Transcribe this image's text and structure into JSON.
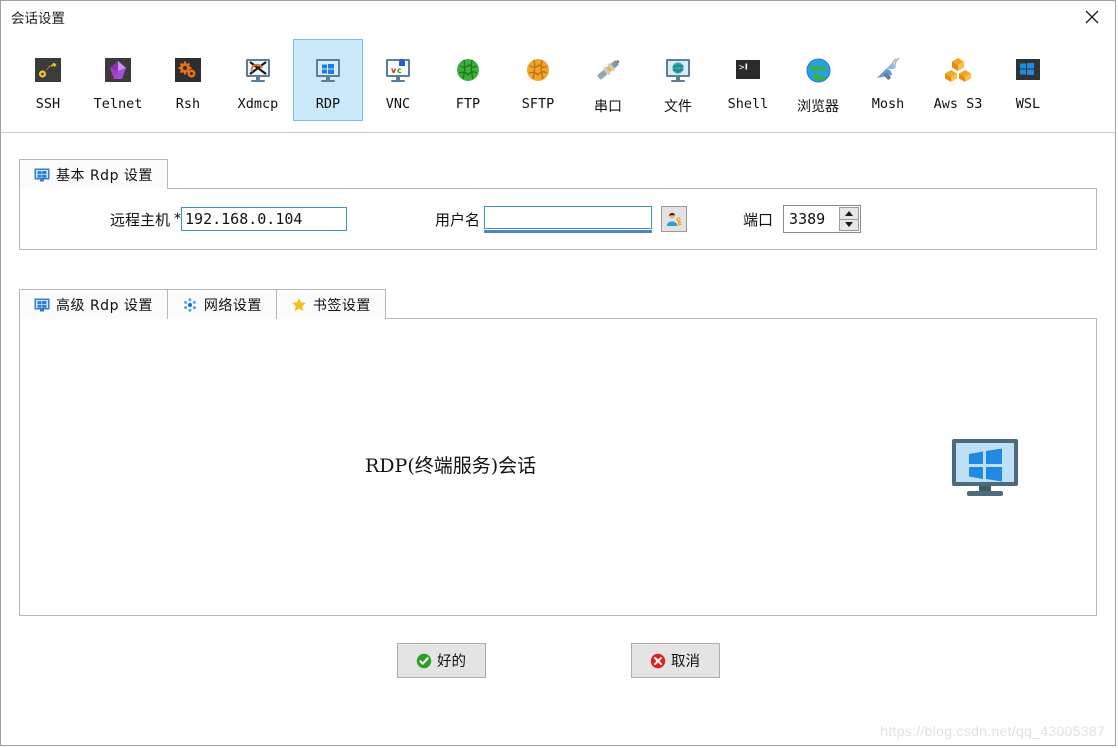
{
  "window": {
    "title": "会话设置",
    "close_icon": "close-icon"
  },
  "protocols": {
    "selected": "RDP",
    "items": [
      {
        "label": "SSH",
        "icon": "key-icon",
        "cjk": false
      },
      {
        "label": "Telnet",
        "icon": "gem-icon",
        "cjk": false
      },
      {
        "label": "Rsh",
        "icon": "gears-icon",
        "cjk": false
      },
      {
        "label": "Xdmcp",
        "icon": "x-monitor-icon",
        "cjk": false
      },
      {
        "label": "RDP",
        "icon": "windows-monitor-icon",
        "cjk": false
      },
      {
        "label": "VNC",
        "icon": "vnc-monitor-icon",
        "cjk": false
      },
      {
        "label": "FTP",
        "icon": "green-globe-icon",
        "cjk": false
      },
      {
        "label": "SFTP",
        "icon": "orange-globe-icon",
        "cjk": false
      },
      {
        "label": "串口",
        "icon": "serial-plug-icon",
        "cjk": true
      },
      {
        "label": "文件",
        "icon": "globe-monitor-icon",
        "cjk": true
      },
      {
        "label": "Shell",
        "icon": "terminal-icon",
        "cjk": false
      },
      {
        "label": "浏览器",
        "icon": "globe-icon",
        "cjk": true
      },
      {
        "label": "Mosh",
        "icon": "satellite-icon",
        "cjk": false
      },
      {
        "label": "Aws S3",
        "icon": "aws-cubes-icon",
        "cjk": false
      },
      {
        "label": "WSL",
        "icon": "windows-icon",
        "cjk": false
      }
    ]
  },
  "basic_section": {
    "tab": {
      "label": "基本 Rdp 设置",
      "icon": "monitor-icon"
    },
    "host": {
      "label": "远程主机",
      "required_mark": "*",
      "value": "192.168.0.104"
    },
    "username": {
      "label": "用户名",
      "value": "",
      "placeholder": "",
      "picker_icon": "user-picker-icon"
    },
    "port": {
      "label": "端口",
      "value": "3389",
      "up_icon": "arrow-up-icon",
      "down_icon": "arrow-down-icon"
    }
  },
  "advanced_section": {
    "tabs": [
      {
        "label": "高级 Rdp 设置",
        "icon": "monitor-icon",
        "active": true
      },
      {
        "label": "网络设置",
        "icon": "network-dots-icon",
        "active": false
      },
      {
        "label": "书签设置",
        "icon": "star-icon",
        "active": false
      }
    ],
    "caption": "RDP(终端服务)会话",
    "illustration_icon": "windows-monitor-large-icon"
  },
  "footer": {
    "ok": {
      "label": "好的",
      "icon": "check-circle-icon",
      "color": "#2aa02a"
    },
    "cancel": {
      "label": "取消",
      "icon": "x-circle-icon",
      "color": "#e02020"
    }
  },
  "watermark": "https://blog.csdn.net/qq_43005387",
  "colors": {
    "selected_tab_bg": "#cce8fb",
    "selected_tab_border": "#7cc0ec",
    "input_border": "#3f8fd0",
    "panel_border": "#b8b8b8"
  }
}
